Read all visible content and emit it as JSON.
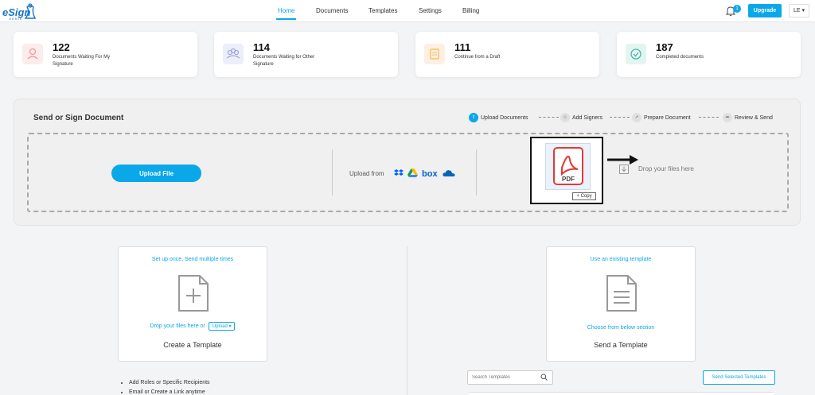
{
  "brand": {
    "logo_text": "eSign",
    "logo_sub": "GENIE"
  },
  "nav": {
    "items": [
      "Home",
      "Documents",
      "Templates",
      "Settings",
      "Billing"
    ],
    "notification_count": "1",
    "upgrade_label": "Upgrade",
    "user_label": "LE ▾"
  },
  "stats": [
    {
      "value": "122",
      "label": "Documents Waiting For My Signature",
      "color": "#ef9a9a"
    },
    {
      "value": "114",
      "label": "Documents Waiting for Other Signature",
      "color": "#9fa8da"
    },
    {
      "value": "111",
      "label": "Continue from a Draft",
      "color": "#ffcc80"
    },
    {
      "value": "187",
      "label": "Completed documents",
      "color": "#80cbc4"
    }
  ],
  "send": {
    "title": "Send or Sign Document",
    "steps": [
      "Upload Documents",
      "Add Signers",
      "Prepare Document",
      "Review & Send"
    ],
    "upload_button": "Upload File",
    "upload_from": "Upload from",
    "pdf_label": "PDF",
    "copy_label": "+ Copy",
    "drop_text": "Drop your files here"
  },
  "create_template": {
    "tag": "Set up once, Send multiple times",
    "drop_hint": "Drop your files here or",
    "upload_small": "Upload ▾",
    "title": "Create a Template"
  },
  "send_template": {
    "tag": "Use an existing template",
    "hint": "Choose from below section",
    "title": "Send a Template"
  },
  "bullets": [
    "Add Roles or Specific Recipients",
    "Email or Create a Link anytime"
  ],
  "search": {
    "placeholder": "Search Templates"
  },
  "send_selected_label": "Send Selected Templates",
  "colors": {
    "accent": "#0aa8e8"
  }
}
